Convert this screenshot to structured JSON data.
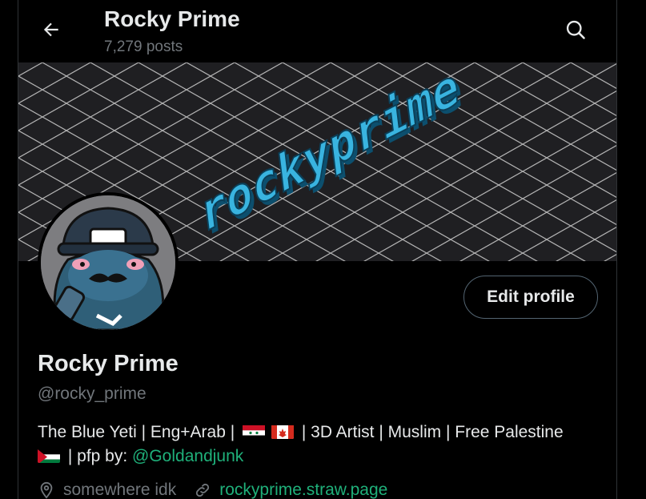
{
  "header": {
    "title": "Rocky Prime",
    "post_count": "7,279 posts",
    "back_icon": "arrow-left-icon",
    "search_icon": "search-icon"
  },
  "banner": {
    "logo_text": "rockyprime",
    "colors": {
      "background": "#1f1f22",
      "grid": "#cfcfcf",
      "logo": "#39b4e0"
    }
  },
  "profile": {
    "display_name": "Rocky Prime",
    "handle": "@rocky_prime",
    "edit_button": "Edit profile",
    "bio": {
      "part1": "The Blue Yeti | Eng+Arab |",
      "part2": "| 3D Artist | Muslim | Free Palestine",
      "part3": "| pfp by:",
      "mention": "@Goldandjunk",
      "flags": [
        "syria-flag",
        "canada-flag",
        "palestine-flag"
      ]
    },
    "location": "somewhere idk",
    "website": "rockyprime.straw.page"
  },
  "colors": {
    "accent": "#1fb07a",
    "text": "#e7e9ea",
    "muted": "#71767b",
    "border": "#536471"
  }
}
